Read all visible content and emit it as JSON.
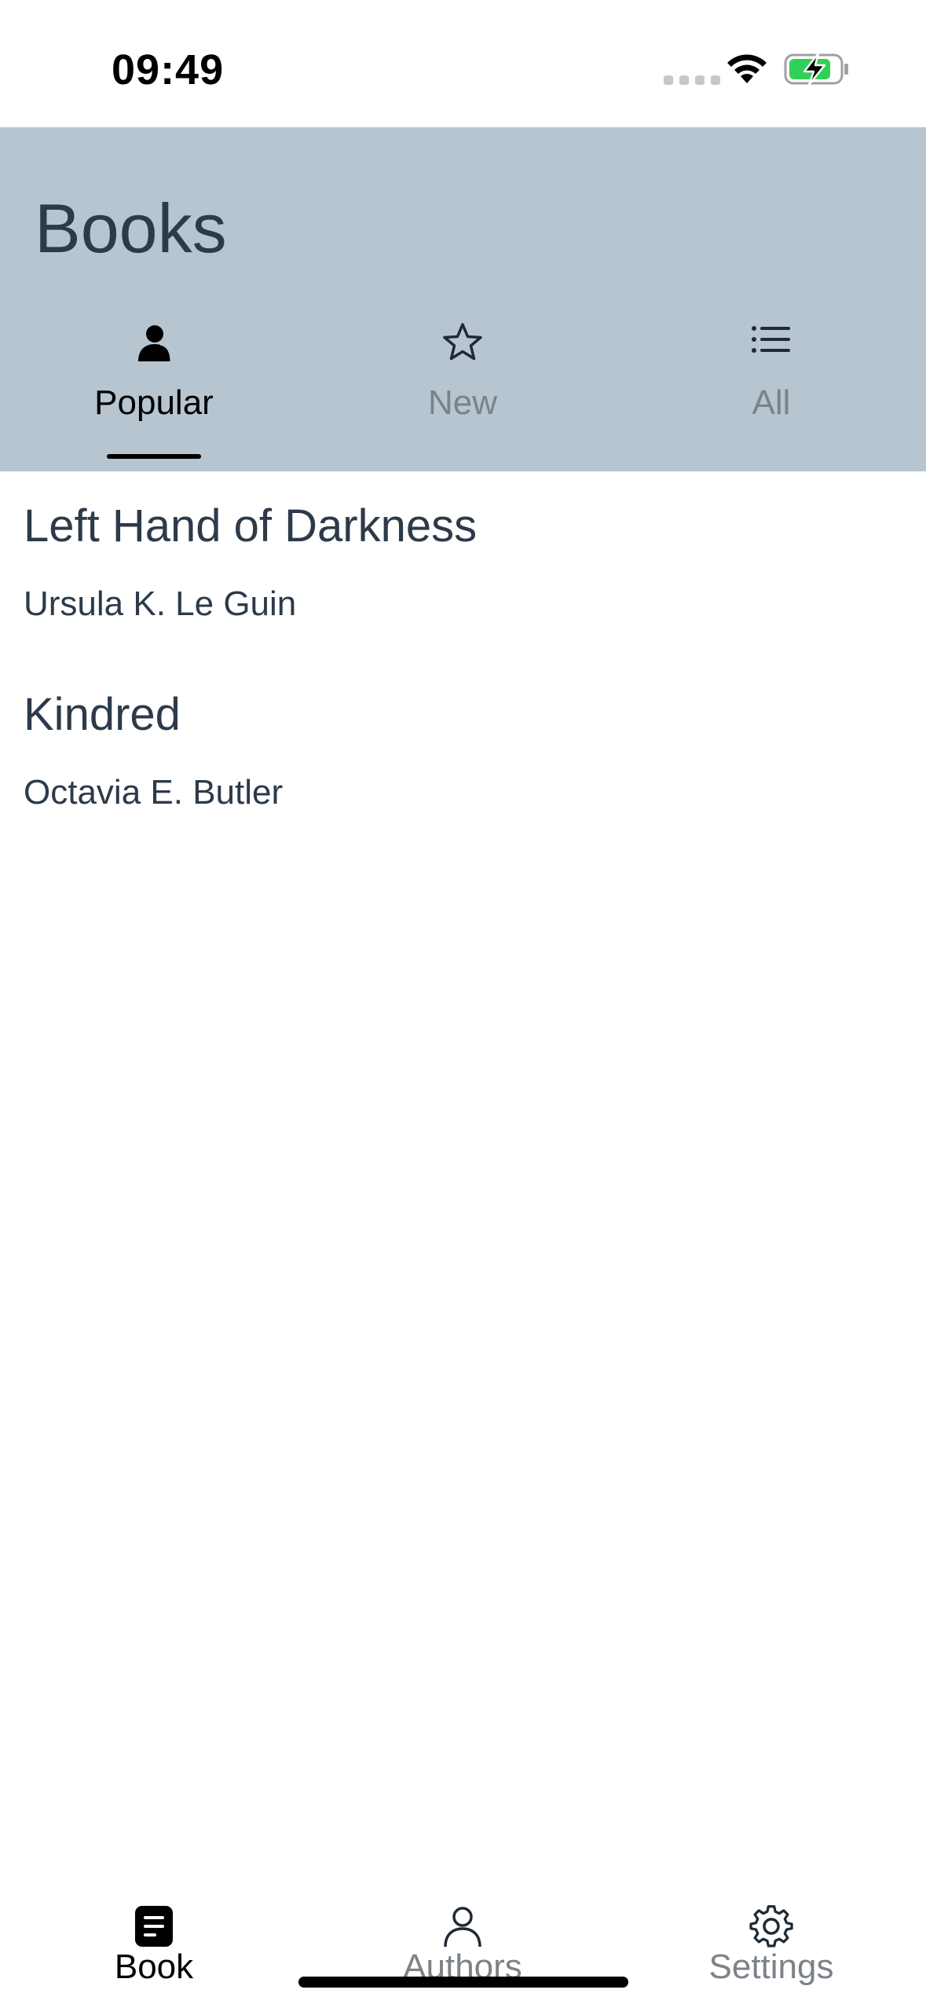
{
  "status_bar": {
    "time": "09:49",
    "signal_icon": "signal-dots-icon",
    "wifi_icon": "wifi-icon",
    "battery_icon": "battery-charging-icon",
    "battery_color": "#30d158"
  },
  "header": {
    "title": "Books",
    "background": "#b7c5d0",
    "tabs": [
      {
        "label": "Popular",
        "icon": "person-icon",
        "active": true
      },
      {
        "label": "New",
        "icon": "star-icon",
        "active": false
      },
      {
        "label": "All",
        "icon": "list-icon",
        "active": false
      }
    ]
  },
  "books": [
    {
      "title": "Left Hand of Darkness",
      "author": "Ursula K. Le Guin"
    },
    {
      "title": "Kindred",
      "author": "Octavia E. Butler"
    }
  ],
  "bottom_tabs": [
    {
      "label": "Book",
      "icon": "book-icon",
      "active": true
    },
    {
      "label": "Authors",
      "icon": "person-outline-icon",
      "active": false
    },
    {
      "label": "Settings",
      "icon": "gear-icon",
      "active": false
    }
  ]
}
